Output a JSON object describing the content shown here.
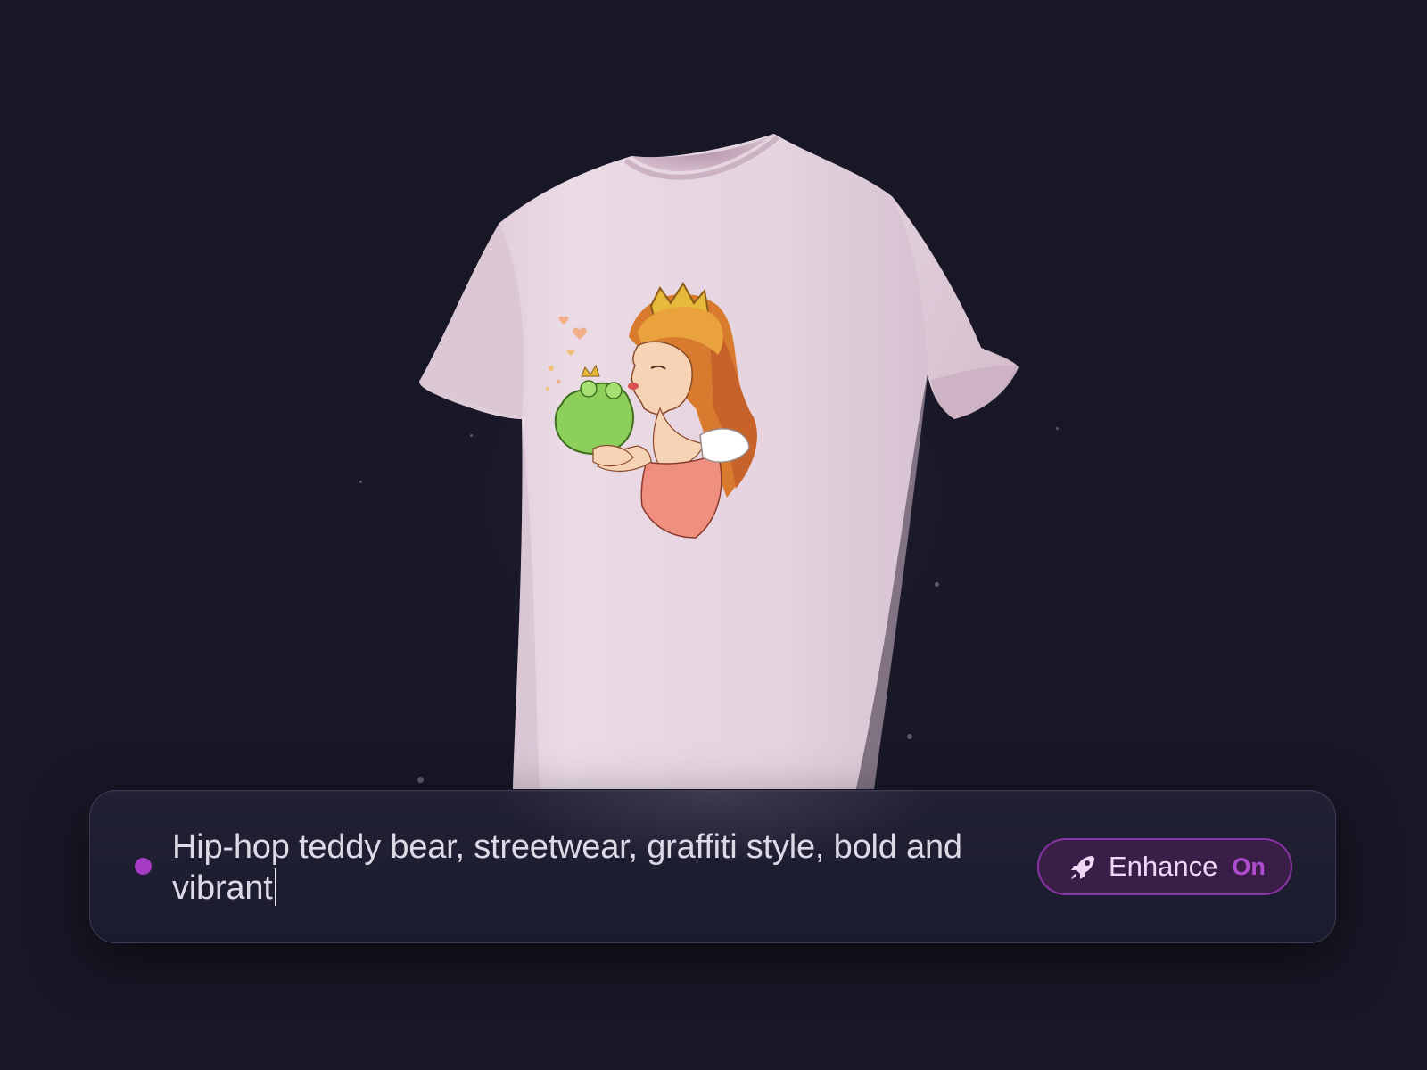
{
  "prompt": {
    "text": "Hip-hop teddy bear, streetwear, graffiti style, bold and vibrant",
    "status_color": "#a53bc3"
  },
  "enhance": {
    "label": "Enhance",
    "state": "On",
    "icon": "rocket-icon",
    "accent": "#b04cd0"
  },
  "preview": {
    "garment": "t-shirt",
    "garment_color": "#e6d3de",
    "print": "princess-kissing-frog-illustration"
  },
  "colors": {
    "background": "#181726",
    "panel": "#1b1b2f",
    "panel_border": "#3b3a52"
  }
}
